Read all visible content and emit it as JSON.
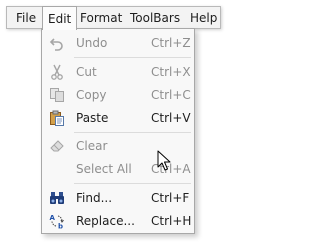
{
  "menubar": {
    "items": [
      {
        "label": "File"
      },
      {
        "label": "Edit"
      },
      {
        "label": "Format"
      },
      {
        "label": "ToolBars"
      },
      {
        "label": "Help"
      }
    ]
  },
  "edit_menu": {
    "items": [
      {
        "label": "Undo",
        "shortcut": "Ctrl+Z",
        "icon": "undo-icon",
        "enabled": false
      },
      {
        "label": "Cut",
        "shortcut": "Ctrl+X",
        "icon": "scissors-icon",
        "enabled": false
      },
      {
        "label": "Copy",
        "shortcut": "Ctrl+C",
        "icon": "copy-icon",
        "enabled": false
      },
      {
        "label": "Paste",
        "shortcut": "Ctrl+V",
        "icon": "clipboard-icon",
        "enabled": true
      },
      {
        "label": "Clear",
        "shortcut": "",
        "icon": "eraser-icon",
        "enabled": false
      },
      {
        "label": "Select All",
        "shortcut": "Ctrl+A",
        "icon": "",
        "enabled": false
      },
      {
        "label": "Find...",
        "shortcut": "Ctrl+F",
        "icon": "binoculars-icon",
        "enabled": true
      },
      {
        "label": "Replace...",
        "shortcut": "Ctrl+H",
        "icon": "replace-icon",
        "enabled": true
      }
    ]
  }
}
